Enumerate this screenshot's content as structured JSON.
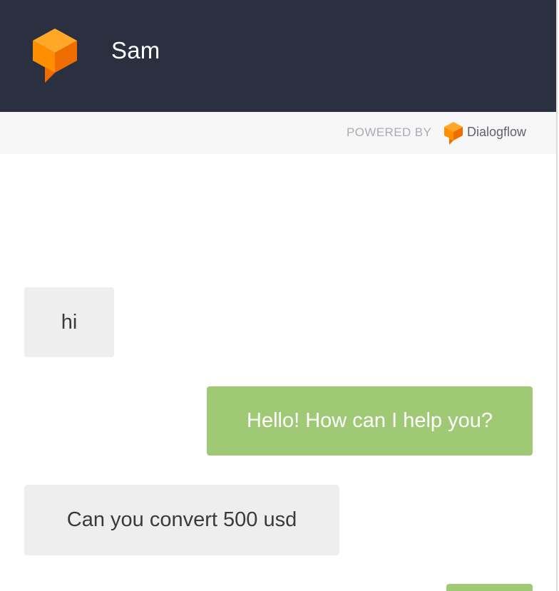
{
  "header": {
    "bot_name": "Sam",
    "logo_icon": "dialogflow-cube-icon",
    "background_color": "#2b3040"
  },
  "powered_by": {
    "label": "POWERED BY",
    "brand_name": "Dialogflow",
    "brand_icon": "dialogflow-cube-icon"
  },
  "colors": {
    "brand_orange": "#ff9800",
    "user_bubble": "#eeeeee",
    "bot_bubble": "#a0c975"
  },
  "messages": [
    {
      "sender": "user",
      "text": "hi"
    },
    {
      "sender": "bot",
      "text": "Hello! How can I help you?"
    },
    {
      "sender": "user",
      "text": "Can you convert 500 usd"
    },
    {
      "sender": "bot",
      "text": ""
    }
  ]
}
